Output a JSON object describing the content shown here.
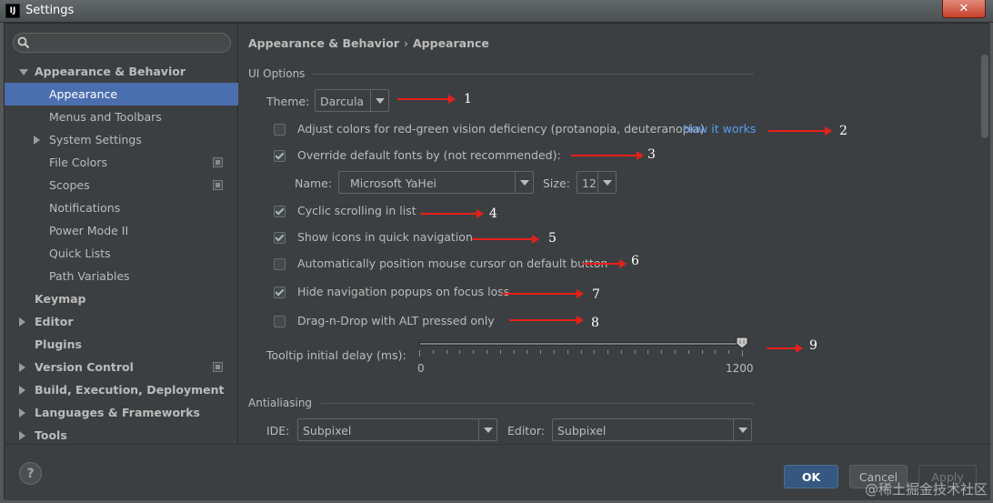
{
  "window": {
    "title": "Settings",
    "logo_text": "IJ",
    "close_glyph": "✕"
  },
  "search": {
    "placeholder": ""
  },
  "sidebar": {
    "items": [
      {
        "label": "Appearance & Behavior",
        "level": 0,
        "bold": true,
        "arrow": "down",
        "selected": false,
        "project_icon": false
      },
      {
        "label": "Appearance",
        "level": 1,
        "bold": false,
        "arrow": "",
        "selected": true,
        "project_icon": false
      },
      {
        "label": "Menus and Toolbars",
        "level": 1,
        "bold": false,
        "arrow": "",
        "selected": false,
        "project_icon": false
      },
      {
        "label": "System Settings",
        "level": 1,
        "bold": false,
        "arrow": "right",
        "selected": false,
        "project_icon": false
      },
      {
        "label": "File Colors",
        "level": 1,
        "bold": false,
        "arrow": "",
        "selected": false,
        "project_icon": true
      },
      {
        "label": "Scopes",
        "level": 1,
        "bold": false,
        "arrow": "",
        "selected": false,
        "project_icon": true
      },
      {
        "label": "Notifications",
        "level": 1,
        "bold": false,
        "arrow": "",
        "selected": false,
        "project_icon": false
      },
      {
        "label": "Power Mode II",
        "level": 1,
        "bold": false,
        "arrow": "",
        "selected": false,
        "project_icon": false
      },
      {
        "label": "Quick Lists",
        "level": 1,
        "bold": false,
        "arrow": "",
        "selected": false,
        "project_icon": false
      },
      {
        "label": "Path Variables",
        "level": 1,
        "bold": false,
        "arrow": "",
        "selected": false,
        "project_icon": false
      },
      {
        "label": "Keymap",
        "level": 0,
        "bold": true,
        "arrow": "",
        "selected": false,
        "project_icon": false
      },
      {
        "label": "Editor",
        "level": 0,
        "bold": true,
        "arrow": "right",
        "selected": false,
        "project_icon": false
      },
      {
        "label": "Plugins",
        "level": 0,
        "bold": true,
        "arrow": "",
        "selected": false,
        "project_icon": false
      },
      {
        "label": "Version Control",
        "level": 0,
        "bold": true,
        "arrow": "right",
        "selected": false,
        "project_icon": true
      },
      {
        "label": "Build, Execution, Deployment",
        "level": 0,
        "bold": true,
        "arrow": "right",
        "selected": false,
        "project_icon": false
      },
      {
        "label": "Languages & Frameworks",
        "level": 0,
        "bold": true,
        "arrow": "right",
        "selected": false,
        "project_icon": false
      },
      {
        "label": "Tools",
        "level": 0,
        "bold": true,
        "arrow": "right",
        "selected": false,
        "project_icon": false
      }
    ]
  },
  "breadcrumb": {
    "parent": "Appearance & Behavior",
    "separator": "›",
    "current": "Appearance"
  },
  "ui_options": {
    "group_title": "UI Options",
    "theme_label": "Theme:",
    "theme_value": "Darcula",
    "adjust_colors": {
      "label": "Adjust colors for red-green vision deficiency (protanopia, deuteranopia)",
      "checked": false,
      "link": "How it works"
    },
    "override_fonts": {
      "label": "Override default fonts by (not recommended):",
      "checked": true
    },
    "font_name_label": "Name:",
    "font_name_value": "Microsoft YaHei",
    "font_size_label": "Size:",
    "font_size_value": "12",
    "cyclic_scrolling": {
      "label": "Cyclic scrolling in list",
      "checked": true
    },
    "show_icons": {
      "label": "Show icons in quick navigation",
      "checked": true
    },
    "auto_position": {
      "label": "Automatically position mouse cursor on default button",
      "checked": false
    },
    "hide_popups": {
      "label": "Hide navigation popups on focus loss",
      "checked": true
    },
    "drag_n_drop": {
      "label": "Drag-n-Drop with ALT pressed only",
      "checked": false
    },
    "tooltip_label": "Tooltip initial delay (ms):",
    "tooltip_min": "0",
    "tooltip_max": "1200",
    "tooltip_value_fraction": 1.0
  },
  "antialiasing": {
    "group_title": "Antialiasing",
    "ide_label": "IDE:",
    "ide_value": "Subpixel",
    "editor_label": "Editor:",
    "editor_value": "Subpixel"
  },
  "annotations": [
    "1",
    "2",
    "3",
    "4",
    "5",
    "6",
    "7",
    "8",
    "9"
  ],
  "annotation_color": "#e8201a",
  "footer": {
    "help": "?",
    "ok": "OK",
    "cancel": "Cancel",
    "apply": "Apply"
  },
  "watermark": "@稀土掘金技术社区",
  "colors": {
    "background": "#3c3f41",
    "selection": "#4b6eaf",
    "link": "#589df6",
    "ok_button": "#365880"
  }
}
